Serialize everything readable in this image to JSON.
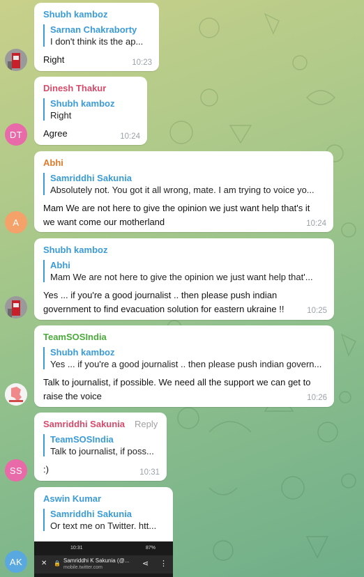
{
  "messages": [
    {
      "sender": "Shubh kamboz",
      "reply_name": "Sarnan Chakraborty",
      "reply_text": "I don't think its the ap...",
      "text": "Right",
      "time": "10:23"
    },
    {
      "sender": "Dinesh Thakur",
      "avatar": "DT",
      "reply_name": "Shubh kamboz",
      "reply_text": "Right",
      "text": "Agree",
      "time": "10:24"
    },
    {
      "sender": "Abhi",
      "avatar": "A",
      "reply_name": "Samriddhi Sakunia",
      "reply_text": "Absolutely not. You got it all wrong, mate.  I am trying to voice yo...",
      "text_line1": "Mam We are not here to give the opinion we just want help that's it",
      "text_line2": "we want come our motherland",
      "time": "10:24"
    },
    {
      "sender": "Shubh kamboz",
      "reply_name": "Abhi",
      "reply_text": "Mam We are not here to give the opinion we just want help that'...",
      "text_line1": "Yes ... if you're a good journalist .. then please push indian",
      "text_line2": "government to find evacuation solution for eastern ukraine !!",
      "time": "10:25"
    },
    {
      "sender": "TeamSOSIndia",
      "reply_name": "Shubh kamboz",
      "reply_text": "Yes ... if you're a good journalist .. then please push indian govern...",
      "text_line1": "Talk to journalist, if possible. We need all the support we can get to",
      "text_line2": "raise the voice",
      "time": "10:26"
    },
    {
      "sender": "Samriddhi Sakunia",
      "avatar": "SS",
      "reply_label": "Reply",
      "reply_name": "TeamSOSIndia",
      "reply_text": "Talk to journalist, if poss...",
      "text": ":)",
      "time": "10:31"
    },
    {
      "sender": "Aswin Kumar",
      "avatar": "AK",
      "reply_name": "Samriddhi Sakunia",
      "reply_text": "Or text me on Twitter. htt...",
      "screenshot": {
        "status_time": "10:31",
        "battery": "87%",
        "page_title": "Samriddhi K Sakunia (@...",
        "page_url": "mobile.twitter.com"
      }
    }
  ],
  "colors": {
    "shubh": "#3a9bd8",
    "dinesh": "#d84a6a",
    "abhi": "#e07a2a",
    "team": "#4bab3a",
    "samriddhi": "#d84a6a",
    "aswin": "#3a9bd8",
    "avatar_dt": "#e86aa8",
    "avatar_a": "#f4a26a",
    "avatar_ss": "#e86aa8",
    "avatar_ak": "#5aa8e0"
  }
}
